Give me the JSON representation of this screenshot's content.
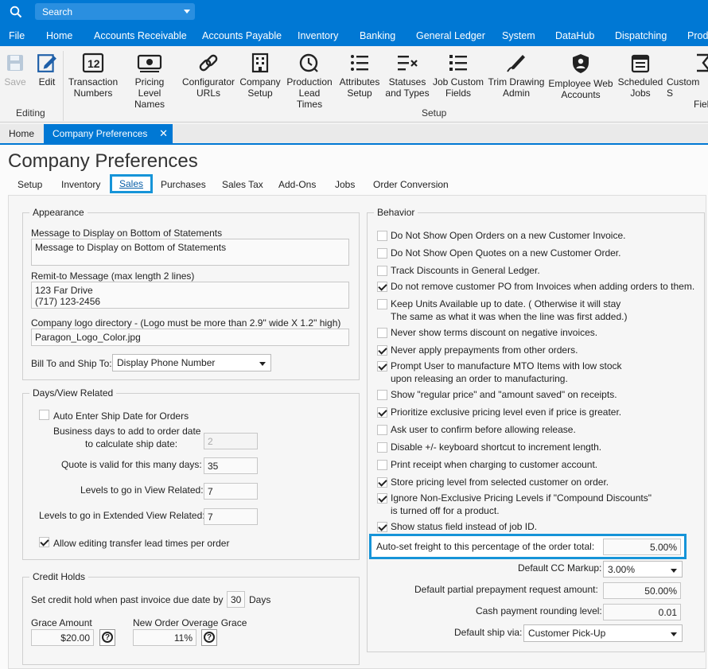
{
  "search": {
    "placeholder": "Search"
  },
  "menu": [
    "File",
    "Home",
    "Accounts Receivable",
    "Accounts Payable",
    "Inventory",
    "Banking",
    "General Ledger",
    "System",
    "DataHub",
    "Dispatching",
    "Prod"
  ],
  "ribbon": {
    "editing_group": "Editing",
    "setup_group": "Setup",
    "save": "Save",
    "edit": "Edit",
    "buttons": [
      {
        "l1": "Transaction",
        "l2": "Numbers",
        "icon": "transaction-numbers-icon"
      },
      {
        "l1": "Pricing",
        "l2": "Level Names",
        "icon": "pricing-icon"
      },
      {
        "l1": "Configurator",
        "l2": "URLs",
        "icon": "link-icon"
      },
      {
        "l1": "Company",
        "l2": "Setup",
        "icon": "building-icon"
      },
      {
        "l1": "Production",
        "l2": "Lead Times",
        "icon": "clock-icon"
      },
      {
        "l1": "Attributes",
        "l2": "Setup",
        "icon": "list-icon"
      },
      {
        "l1": "Statuses",
        "l2": "and Types",
        "icon": "status-list-icon"
      },
      {
        "l1": "Job Custom",
        "l2": "Fields",
        "icon": "fields-icon"
      },
      {
        "l1": "Trim Drawing",
        "l2": "Admin",
        "icon": "pen-icon"
      },
      {
        "l1": "Employee Web",
        "l2": "Accounts",
        "icon": "shield-user-icon"
      },
      {
        "l1": "Scheduled",
        "l2": "Jobs",
        "icon": "calendar-icon"
      },
      {
        "l1": "Custom S",
        "l2": "Field",
        "icon": "sigma-icon"
      }
    ]
  },
  "doc_tabs": {
    "home": "Home",
    "active": "Company Preferences",
    "close": "✕"
  },
  "page_title": "Company Preferences",
  "sub_tabs": [
    "Setup",
    "Inventory",
    "Sales",
    "Purchases",
    "Sales Tax",
    "Add-Ons",
    "Jobs",
    "Order Conversion"
  ],
  "appearance": {
    "legend": "Appearance",
    "msg_label": "Message to Display on Bottom of Statements",
    "msg_value": "Message to Display on Bottom of Statements",
    "remit_label": "Remit-to Message (max length 2 lines)",
    "remit_value": "123 Far Drive\n(717) 123-2456",
    "logo_label": "Company logo directory - (Logo must be more than 2.9\" wide X 1.2\" high)",
    "logo_value": "Paragon_Logo_Color.jpg",
    "billship_label": "Bill To and Ship To:",
    "billship_value": "Display Phone Number"
  },
  "days": {
    "legend": "Days/View Related",
    "auto_ship": "Auto Enter Ship Date for Orders",
    "bizdays_l1": "Business days to add to order date",
    "bizdays_l2": "to calculate ship date:",
    "bizdays_value": "2",
    "quote_label": "Quote is valid for this many days:",
    "quote_value": "35",
    "levels_label": "Levels to go in View Related:",
    "levels_value": "7",
    "ext_label": "Levels to go in Extended View Related:",
    "ext_value": "7",
    "allow_transfer": "Allow editing transfer lead times per order"
  },
  "credit": {
    "legend": "Credit Holds",
    "set_label": "Set credit hold when past invoice due date by",
    "set_value": "30",
    "days": "Days",
    "grace_label": "Grace Amount",
    "grace_value": "$20.00",
    "overage_label": "New Order Overage Grace",
    "overage_value": "11%"
  },
  "behavior": {
    "legend": "Behavior",
    "items": [
      {
        "l1": "Do Not Show Open Orders on a new Customer Invoice.",
        "l2": "",
        "checked": false
      },
      {
        "l1": "Do Not Show Open Quotes on a new Customer Order.",
        "l2": "",
        "checked": false
      },
      {
        "l1": "Track Discounts in General Ledger.",
        "l2": "",
        "checked": false
      },
      {
        "l1": "Do not remove customer PO from Invoices when adding orders to them.",
        "l2": "",
        "checked": true
      },
      {
        "l1": "Keep Units Available up to date. ( Otherwise it will stay",
        "l2": "The same as what it was when the line was first added.)",
        "checked": false
      },
      {
        "l1": "Never show terms discount on negative invoices.",
        "l2": "",
        "checked": false
      },
      {
        "l1": "Never apply prepayments from other orders.",
        "l2": "",
        "checked": true
      },
      {
        "l1": "Prompt User to manufacture MTO Items with low stock",
        "l2": "upon releasing an order to manufacturing.",
        "checked": true
      },
      {
        "l1": "Show \"regular price\" and \"amount saved\" on receipts.",
        "l2": "",
        "checked": false
      },
      {
        "l1": "Prioritize exclusive pricing level even if price is greater.",
        "l2": "",
        "checked": true
      },
      {
        "l1": "Ask user to confirm before allowing release.",
        "l2": "",
        "checked": false
      },
      {
        "l1": "Disable +/- keyboard shortcut to increment length.",
        "l2": "",
        "checked": false
      },
      {
        "l1": "Print receipt when charging to customer account.",
        "l2": "",
        "checked": false
      },
      {
        "l1": "Store pricing level from selected customer on order.",
        "l2": "",
        "checked": true
      },
      {
        "l1": "Ignore Non-Exclusive Pricing Levels if \"Compound Discounts\"",
        "l2": "is turned off for a product.",
        "checked": true
      },
      {
        "l1": "Show status field instead of job ID.",
        "l2": "",
        "checked": true
      }
    ],
    "freight_label": "Auto-set freight to this percentage of the order total:",
    "freight_value": "5.00%",
    "cc_label": "Default CC Markup:",
    "cc_value": "3.00%",
    "partial_label": "Default partial prepayment request amount:",
    "partial_value": "50.00%",
    "rounding_label": "Cash payment rounding level:",
    "rounding_value": "0.01",
    "shipvia_label": "Default ship via:",
    "shipvia_value": "Customer Pick-Up"
  }
}
